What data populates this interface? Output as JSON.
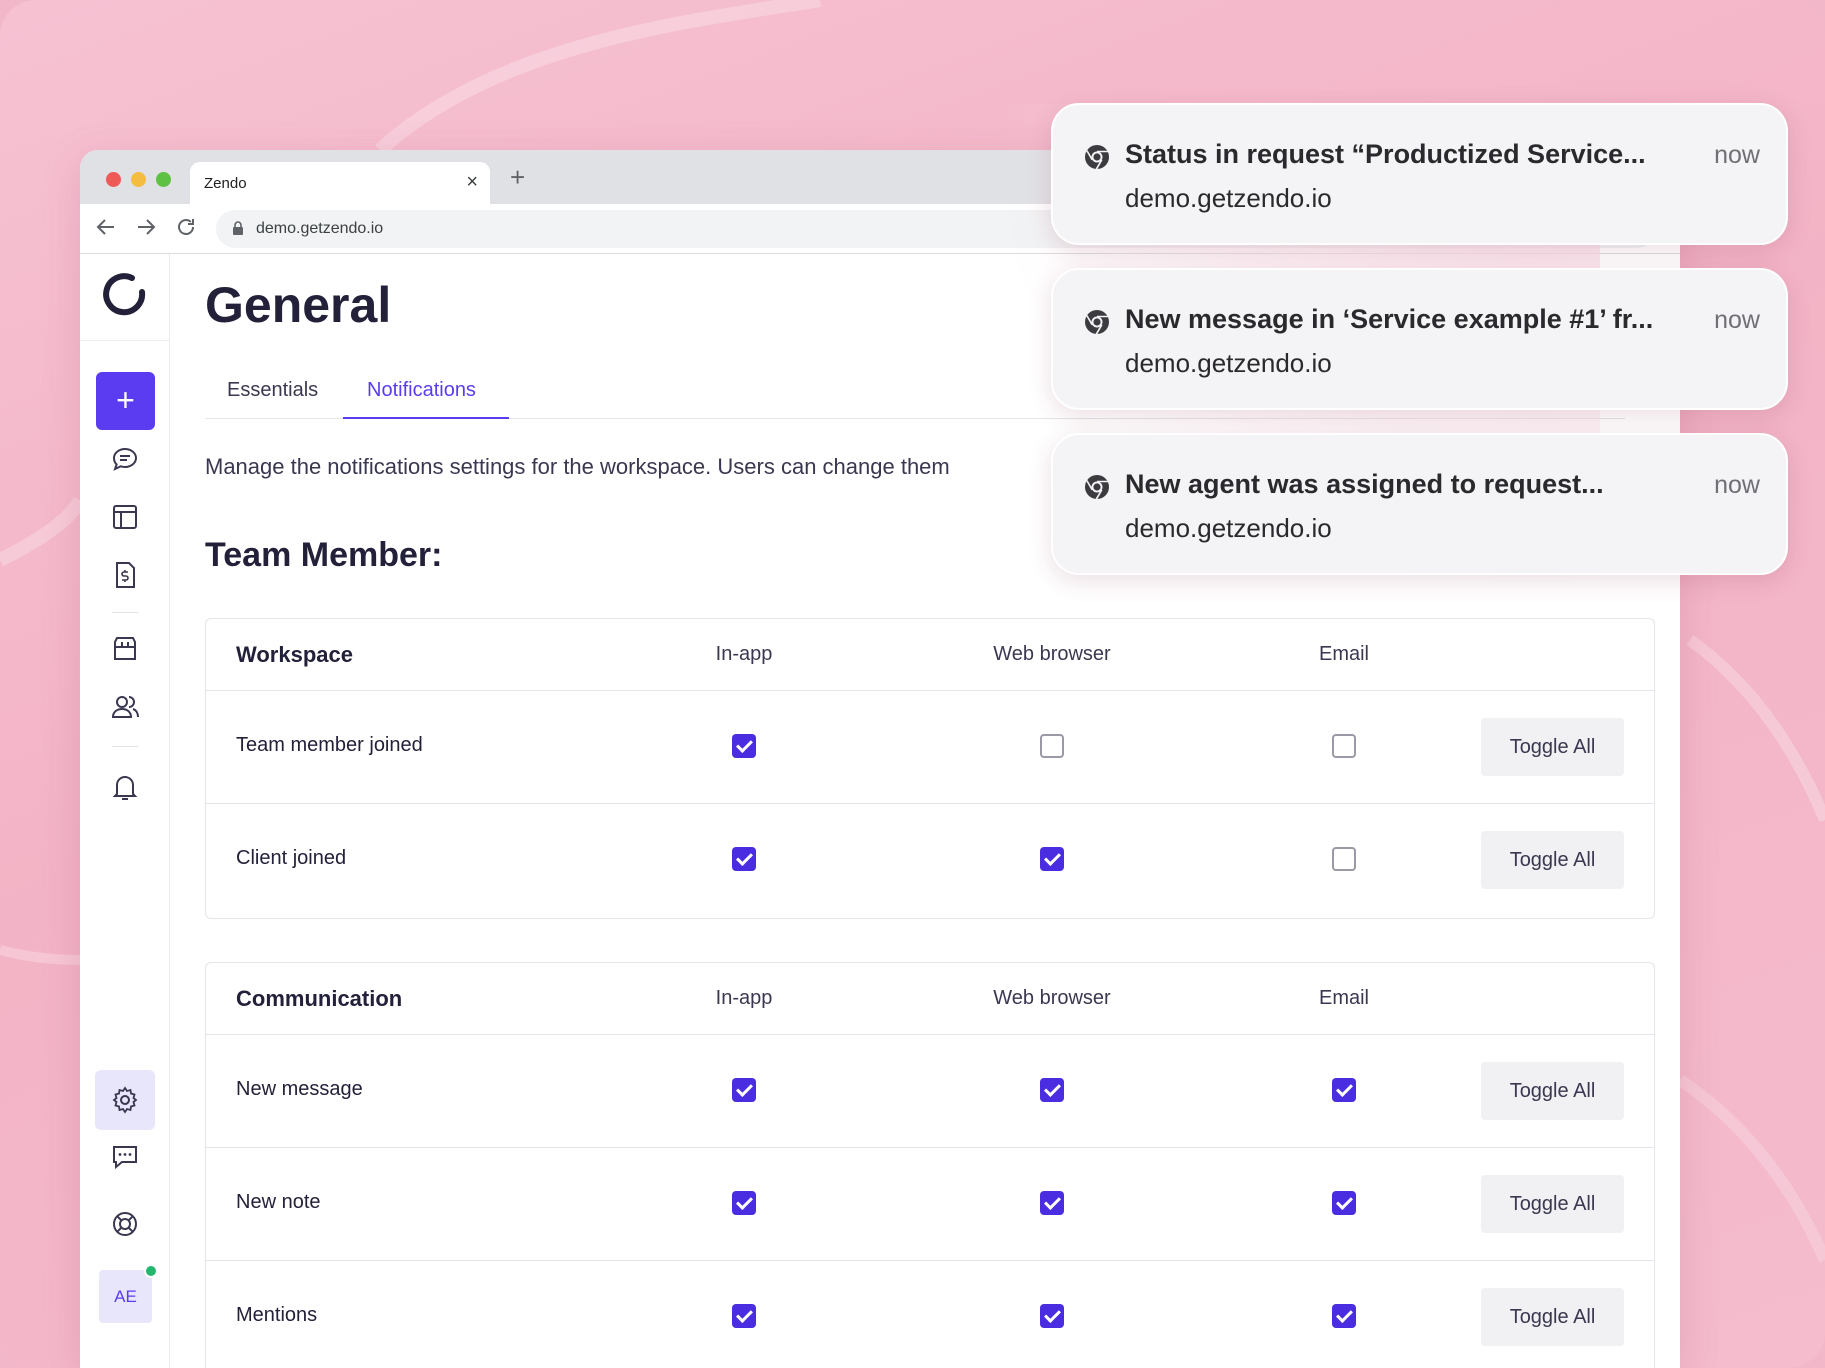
{
  "browser": {
    "tab_title": "Zendo",
    "tab_close": "×",
    "new_tab": "+",
    "url": "demo.getzendo.io"
  },
  "sidebar": {
    "add_label": "+",
    "avatar_initials": "AE"
  },
  "page": {
    "title": "General",
    "tabs": [
      {
        "label": "Essentials",
        "active": false
      },
      {
        "label": "Notifications",
        "active": true
      }
    ],
    "description": "Manage the notifications settings for the workspace. Users can change them",
    "section_title": "Team Member:"
  },
  "columns": {
    "in_app": "In-app",
    "web_browser": "Web browser",
    "email": "Email",
    "toggle_label": "Toggle All"
  },
  "workspace": {
    "title": "Workspace",
    "rows": [
      {
        "label": "Team member joined",
        "in_app": true,
        "web_browser": false,
        "email": false
      },
      {
        "label": "Client joined",
        "in_app": true,
        "web_browser": true,
        "email": false
      }
    ]
  },
  "communication": {
    "title": "Communication",
    "rows": [
      {
        "label": "New message",
        "in_app": true,
        "web_browser": true,
        "email": true
      },
      {
        "label": "New note",
        "in_app": true,
        "web_browser": true,
        "email": true
      },
      {
        "label": "Mentions",
        "in_app": true,
        "web_browser": true,
        "email": true
      }
    ]
  },
  "notifications": [
    {
      "title": "Status in request “Productized Service...",
      "site": "demo.getzendo.io",
      "time": "now"
    },
    {
      "title": "New message in ‘Service example #1’ fr...",
      "site": "demo.getzendo.io",
      "time": "now"
    },
    {
      "title": "New agent was assigned to request...",
      "site": "demo.getzendo.io",
      "time": "now"
    }
  ],
  "colors": {
    "accent": "#5b3cf0",
    "checkbox": "#4a2de0",
    "background": "#f3b3c6"
  }
}
